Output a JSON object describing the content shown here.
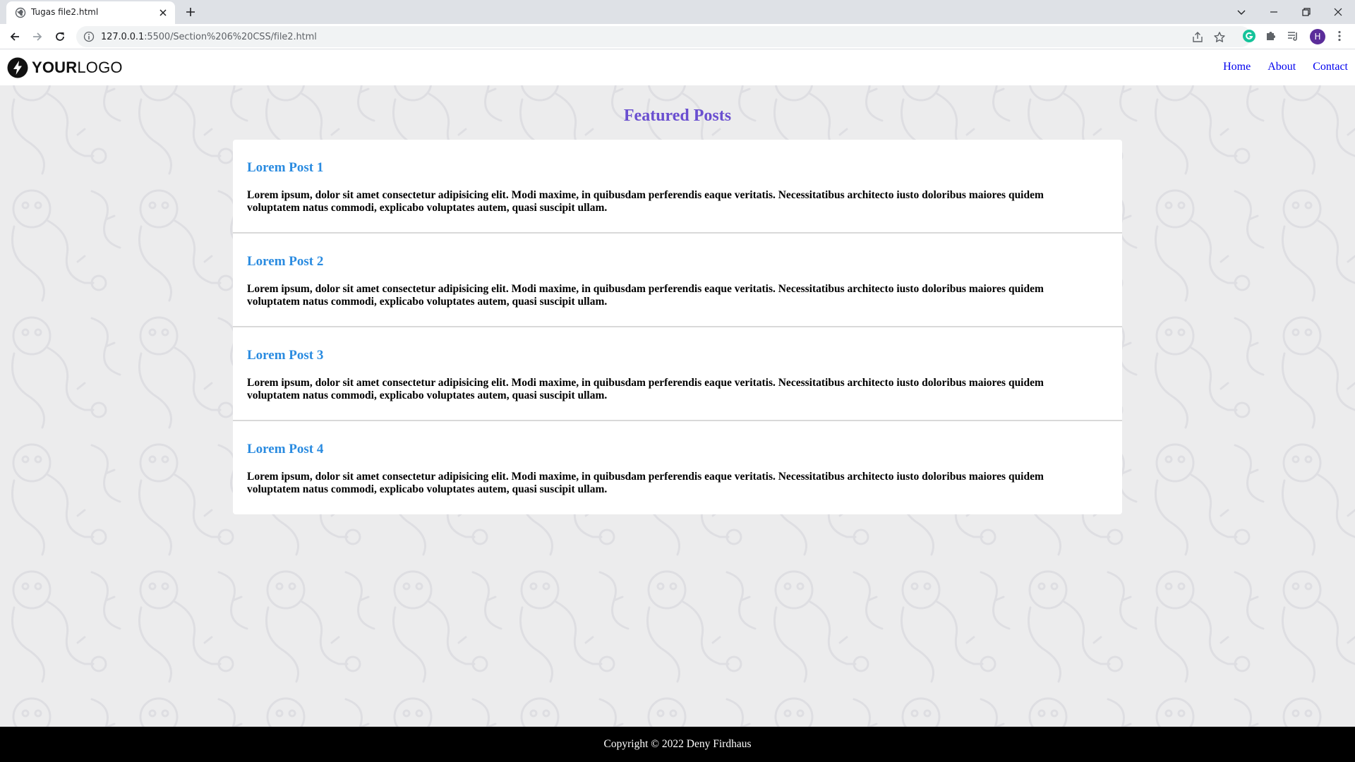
{
  "browser": {
    "tab_title": "Tugas file2.html",
    "url_host": "127.0.0.1",
    "url_path": ":5500/Section%206%20CSS/file2.html",
    "profile_initial": "H"
  },
  "site": {
    "logo_bold": "YOUR",
    "logo_light": "LOGO",
    "nav": [
      {
        "label": "Home"
      },
      {
        "label": "About"
      },
      {
        "label": "Contact"
      }
    ],
    "section_title": "Featured Posts",
    "posts": [
      {
        "title": "Lorem Post 1",
        "body": "Lorem ipsum, dolor sit amet consectetur adipisicing elit. Modi maxime, in quibusdam perferendis eaque veritatis. Necessitatibus architecto iusto doloribus maiores quidem voluptatem natus commodi, explicabo voluptates autem, quasi suscipit ullam."
      },
      {
        "title": "Lorem Post 2",
        "body": "Lorem ipsum, dolor sit amet consectetur adipisicing elit. Modi maxime, in quibusdam perferendis eaque veritatis. Necessitatibus architecto iusto doloribus maiores quidem voluptatem natus commodi, explicabo voluptates autem, quasi suscipit ullam."
      },
      {
        "title": "Lorem Post 3",
        "body": "Lorem ipsum, dolor sit amet consectetur adipisicing elit. Modi maxime, in quibusdam perferendis eaque veritatis. Necessitatibus architecto iusto doloribus maiores quidem voluptatem natus commodi, explicabo voluptates autem, quasi suscipit ullam."
      },
      {
        "title": "Lorem Post 4",
        "body": "Lorem ipsum, dolor sit amet consectetur adipisicing elit. Modi maxime, in quibusdam perferendis eaque veritatis. Necessitatibus architecto iusto doloribus maiores quidem voluptatem natus commodi, explicabo voluptates autem, quasi suscipit ullam."
      }
    ],
    "footer": "Copyright © 2022 Deny Firdhaus"
  },
  "colors": {
    "section_title": "#6a4fd0",
    "post_title": "#2a8be0",
    "nav_link": "#0000ee",
    "page_bg": "#ececed",
    "footer_bg": "#000000"
  },
  "icons": {
    "tab_favicon": "globe-icon",
    "tab_close": "close-icon",
    "new_tab": "plus-icon",
    "back": "arrow-left-icon",
    "forward": "arrow-right-icon",
    "reload": "reload-icon",
    "site_info": "info-icon",
    "share": "share-icon",
    "bookmark": "star-icon",
    "grammarly": "grammarly-icon",
    "extensions": "puzzle-icon",
    "reading_list": "reading-list-icon",
    "menu": "kebab-menu-icon",
    "logo": "lightning-bolt-icon"
  }
}
